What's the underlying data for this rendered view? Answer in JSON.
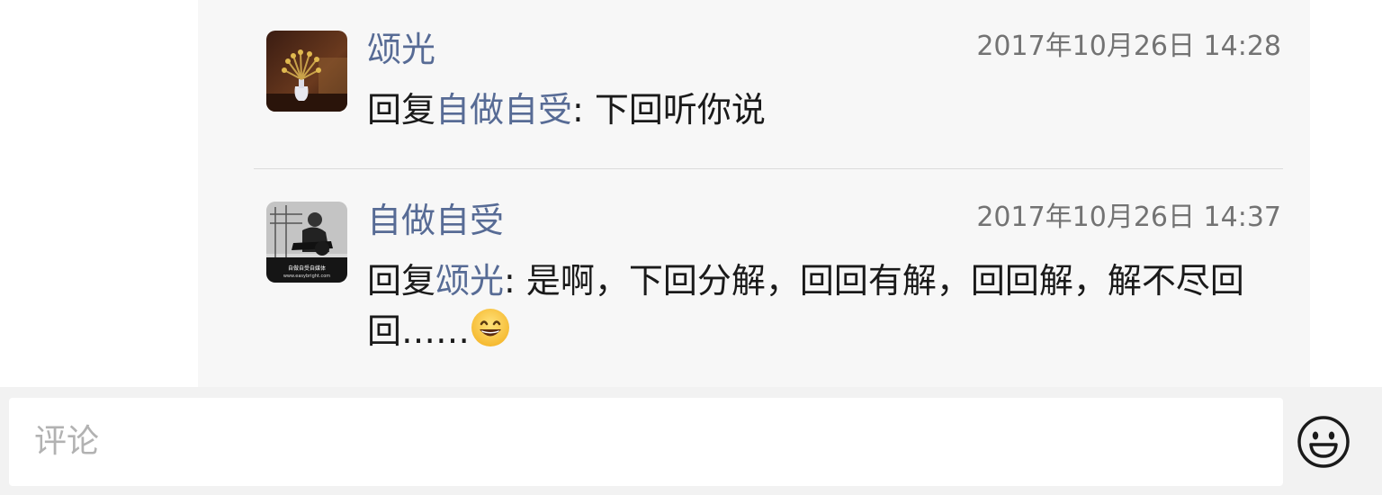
{
  "comments": [
    {
      "author": "颂光",
      "time": "2017年10月26日 14:28",
      "reply_prefix": "回复",
      "reply_to": "自做自受",
      "text": ": 下回听你说"
    },
    {
      "author": "自做自受",
      "time": "2017年10月26日 14:37",
      "reply_prefix": "回复",
      "reply_to": "颂光",
      "text": ": 是啊，下回分解，回回有解，回回解，解不尽回回……",
      "emoji": "smiling-face-emoji",
      "avatar_caption": "自做自受自媒体",
      "avatar_url_text": "www.easybright.com"
    }
  ],
  "comment_input": {
    "placeholder": "评论"
  },
  "icons": {
    "emoji_button": "smiley-face-icon"
  },
  "colors": {
    "link_name": "#576b95",
    "panel_bg": "#f7f7f7",
    "timestamp": "#737373",
    "placeholder": "#b2b2b2"
  }
}
